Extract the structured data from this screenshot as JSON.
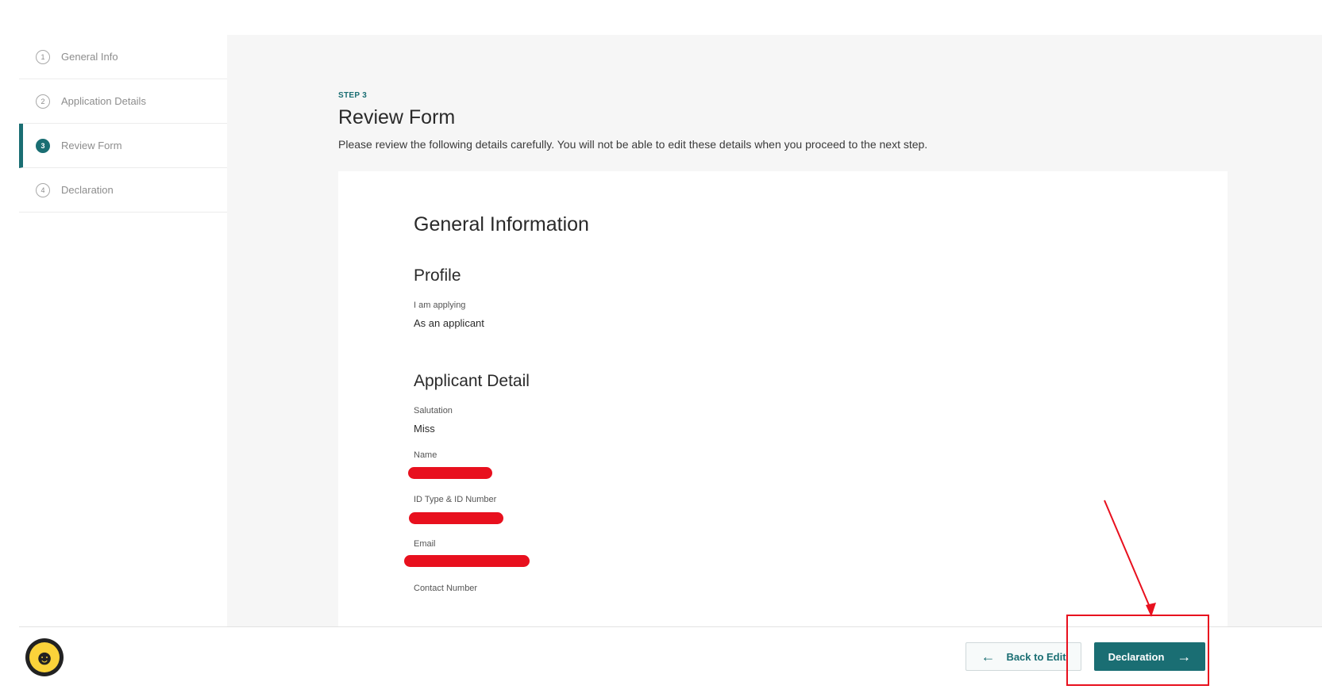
{
  "sidebar": {
    "steps": [
      {
        "num": "1",
        "label": "General Info"
      },
      {
        "num": "2",
        "label": "Application Details"
      },
      {
        "num": "3",
        "label": "Review Form"
      },
      {
        "num": "4",
        "label": "Declaration"
      }
    ],
    "active_step": 3
  },
  "header": {
    "step_tag": "STEP 3",
    "title": "Review Form",
    "description": "Please review the following details carefully. You will not be able to edit these details when you proceed to the next step."
  },
  "review": {
    "section_title": "General Information",
    "profile": {
      "heading": "Profile",
      "applying_label": "I am applying",
      "applying_value": "As an applicant"
    },
    "applicant": {
      "heading": "Applicant Detail",
      "salutation_label": "Salutation",
      "salutation_value": "Miss",
      "name_label": "Name",
      "id_label": "ID Type & ID Number",
      "email_label": "Email",
      "contact_label": "Contact Number"
    }
  },
  "footer": {
    "back_label": "Back to Edit",
    "next_label": "Declaration",
    "back_icon": "arrow-left-icon",
    "next_icon": "arrow-right-icon",
    "avatar_icon": "smiley-face-icon"
  },
  "colors": {
    "accent": "#1a6e73",
    "annotation": "#e8101e"
  }
}
